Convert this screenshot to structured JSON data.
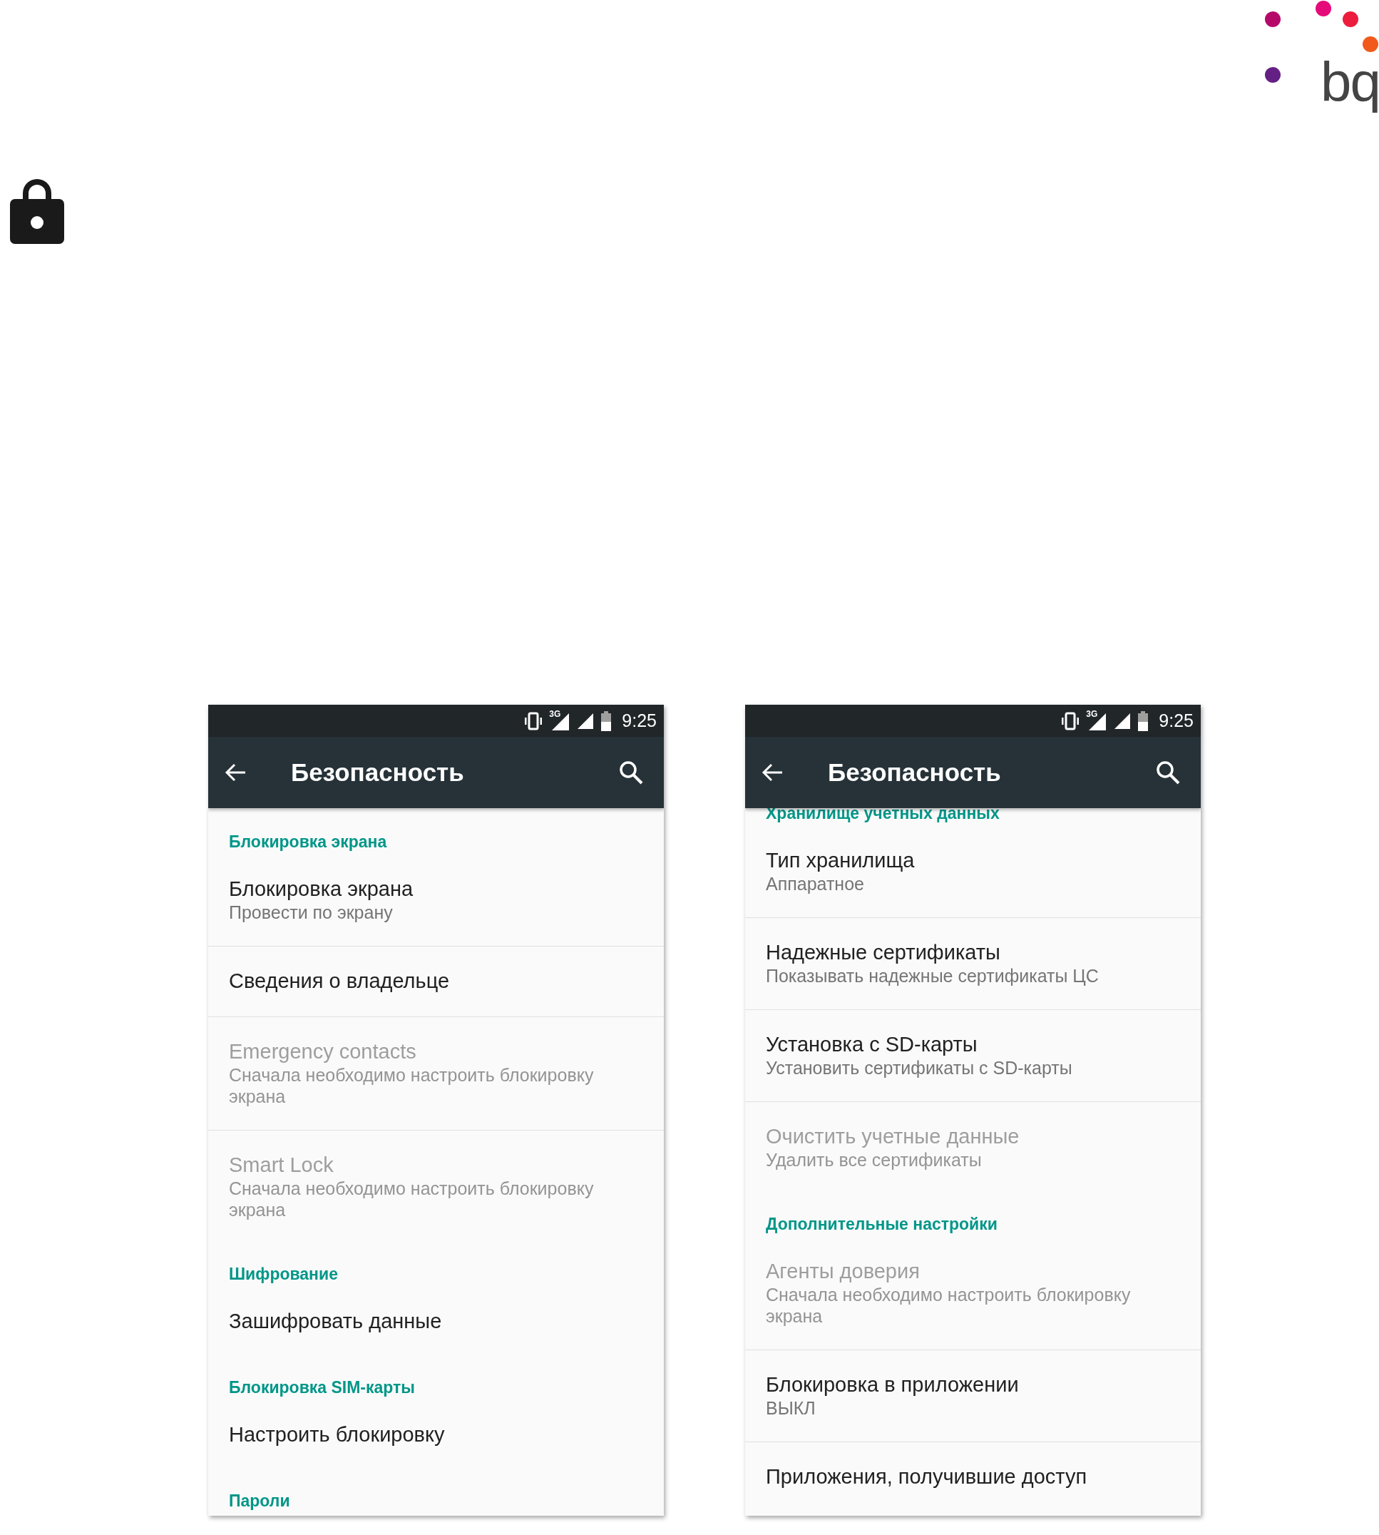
{
  "logo": {
    "text": "bq"
  },
  "screens": [
    {
      "status_bar": {
        "network": "3G",
        "time": "9:25"
      },
      "toolbar": {
        "title": "Безопасность"
      },
      "list": [
        {
          "kind": "category",
          "title": "Блокировка экрана"
        },
        {
          "kind": "item",
          "title": "Блокировка экрана",
          "summary": "Провести по экрану",
          "disabled": false
        },
        {
          "kind": "item",
          "title": "Сведения о владельце",
          "disabled": false
        },
        {
          "kind": "item",
          "title": "Emergency contacts",
          "summary": "Сначала необходимо настроить блокировку экрана",
          "disabled": true
        },
        {
          "kind": "item",
          "title": "Smart Lock",
          "summary": "Сначала необходимо настроить блокировку экрана",
          "disabled": true
        },
        {
          "kind": "category",
          "title": "Шифрование"
        },
        {
          "kind": "item",
          "title": "Зашифровать данные",
          "disabled": false
        },
        {
          "kind": "category",
          "title": "Блокировка SIM-карты"
        },
        {
          "kind": "item",
          "title": "Настроить блокировку",
          "disabled": false
        },
        {
          "kind": "category",
          "title": "Пароли"
        }
      ]
    },
    {
      "status_bar": {
        "network": "3G",
        "time": "9:25"
      },
      "toolbar": {
        "title": "Безопасность"
      },
      "list": [
        {
          "kind": "category",
          "title": "Хранилище учетных данных"
        },
        {
          "kind": "item",
          "title": "Тип хранилища",
          "summary": "Аппаратное",
          "disabled": false
        },
        {
          "kind": "item",
          "title": "Надежные сертификаты",
          "summary": "Показывать надежные сертификаты ЦС",
          "disabled": false
        },
        {
          "kind": "item",
          "title": "Установка с SD-карты",
          "summary": "Установить сертификаты с SD-карты",
          "disabled": false
        },
        {
          "kind": "item",
          "title": "Очистить учетные данные",
          "summary": "Удалить все сертификаты",
          "disabled": true
        },
        {
          "kind": "category",
          "title": "Дополнительные настройки"
        },
        {
          "kind": "item",
          "title": "Агенты доверия",
          "summary": "Сначала необходимо настроить блокировку экрана",
          "disabled": true
        },
        {
          "kind": "item",
          "title": "Блокировка в приложении",
          "summary": "ВЫКЛ",
          "disabled": false
        },
        {
          "kind": "item",
          "title": "Приложения, получившие доступ",
          "disabled": false
        }
      ]
    }
  ]
}
